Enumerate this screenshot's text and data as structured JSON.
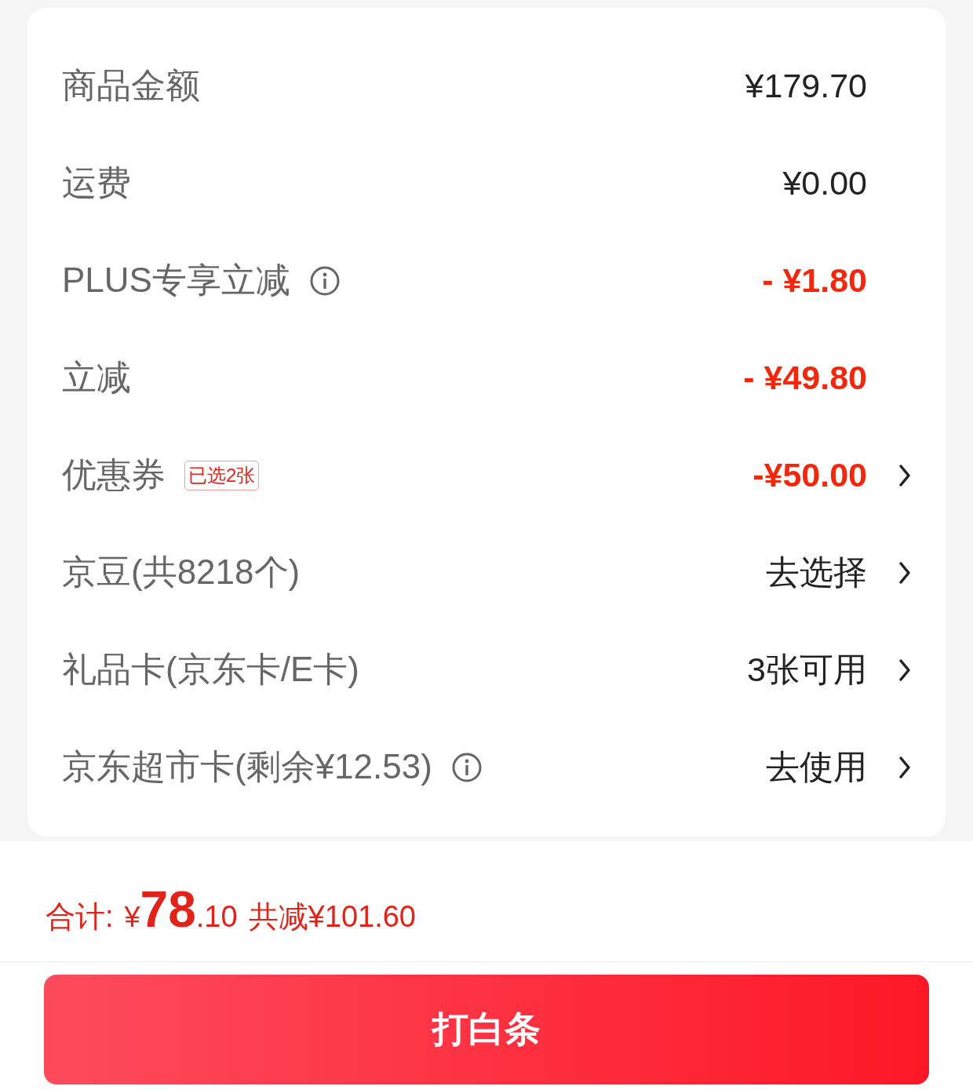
{
  "summary": [
    {
      "label": "商品金额",
      "info": false,
      "value": "¥179.70",
      "negative": false,
      "arrow": false
    },
    {
      "label": "运费",
      "info": false,
      "value": "¥0.00",
      "negative": false,
      "arrow": false
    },
    {
      "label": "PLUS专享立减",
      "info": true,
      "value": "- ¥1.80",
      "negative": true,
      "arrow": false
    },
    {
      "label": "立减",
      "info": false,
      "value": "- ¥49.80",
      "negative": true,
      "arrow": false
    },
    {
      "label": "优惠券",
      "info": false,
      "badge": "已选2张",
      "value": "-¥50.00",
      "negative": true,
      "arrow": true
    },
    {
      "label": "京豆(共8218个)",
      "info": false,
      "value": "去选择",
      "negative": false,
      "arrow": true
    },
    {
      "label": "礼品卡(京东卡/E卡)",
      "info": false,
      "value": "3张可用",
      "negative": false,
      "arrow": true
    },
    {
      "label": "京东超市卡(剩余¥12.53)",
      "info": true,
      "value": "去使用",
      "negative": false,
      "arrow": true
    }
  ],
  "total": {
    "label": "合计:",
    "currency": "¥",
    "integer": "78",
    "decimal": ".10",
    "saving": "共减¥101.60"
  },
  "pay_button": "打白条"
}
